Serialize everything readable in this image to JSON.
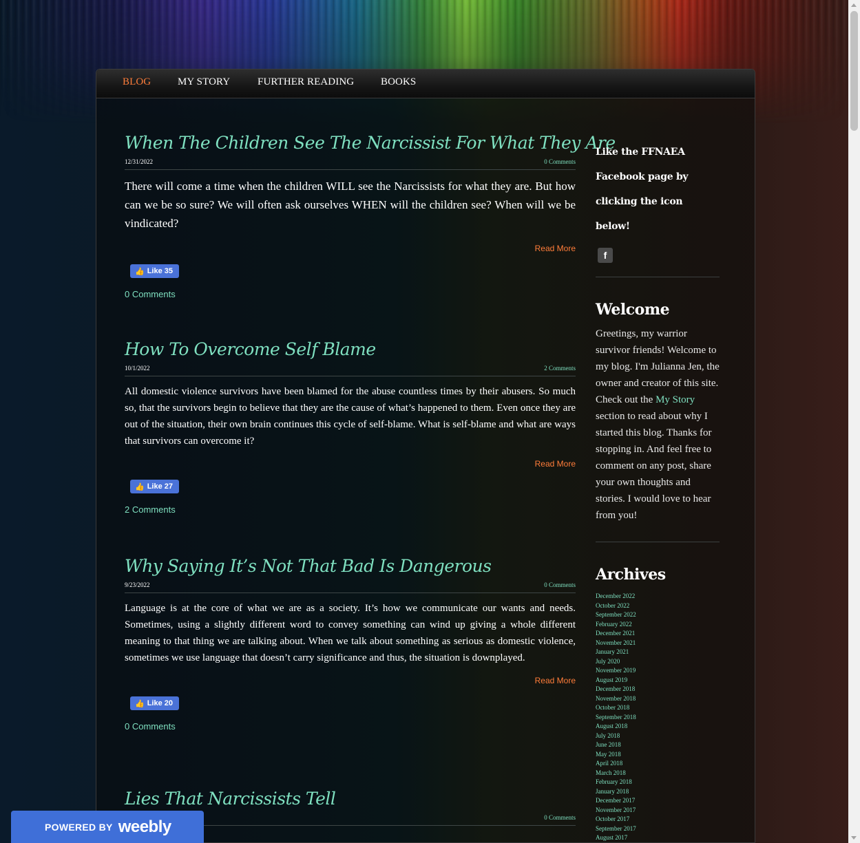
{
  "nav": {
    "items": [
      {
        "label": "BLOG",
        "active": true
      },
      {
        "label": "MY STORY",
        "active": false
      },
      {
        "label": "FURTHER READING",
        "active": false
      },
      {
        "label": "BOOKS",
        "active": false
      }
    ]
  },
  "posts": [
    {
      "title": "When The Children See The Narcissist For What They Are",
      "date": "12/31/2022",
      "comments_link": "0 Comments",
      "excerpt": "There will come a time when the children WILL see the Narcissists for what they are. But how can we be so sure? We will often ask ourselves WHEN will the children see? When will we be vindicated?",
      "read_more": "Read More",
      "like_label": "Like 35",
      "comments_count": "0 Comments"
    },
    {
      "title": "How To Overcome Self Blame",
      "date": "10/1/2022",
      "comments_link": "2 Comments",
      "excerpt": "All domestic violence survivors have been blamed for the abuse countless times by their abusers. So much so, that the survivors begin to believe that they are the cause of what’s happened to them. Even once they are out of the situation, their own brain continues this cycle of self-blame. What is self-blame and what are ways that survivors can overcome it?",
      "read_more": "Read More",
      "like_label": "Like 27",
      "comments_count": "2 Comments"
    },
    {
      "title": "Why Saying It’s Not That Bad Is Dangerous",
      "date": "9/23/2022",
      "comments_link": "0 Comments",
      "excerpt": "Language is at the core of what we are as a society. It’s how we communicate our wants and needs. Sometimes, using a slightly different word to convey something can wind up giving a whole different meaning to that thing we are talking about. When we talk about something as serious as domestic violence, sometimes we use language that doesn’t carry significance and thus, the situation is downplayed.",
      "read_more": "Read More",
      "like_label": "Like 20",
      "comments_count": "0 Comments"
    },
    {
      "title": "Lies That Narcissists Tell",
      "comments_link": "0 Comments"
    }
  ],
  "sidebar": {
    "fb_lines": [
      "Like the FFNAEA",
      "Facebook page by",
      "clicking the icon below!"
    ],
    "fb_icon": "f",
    "welcome_heading": "Welcome",
    "welcome_before": "Greetings, my warrior survivor friends! Welcome to my blog. I'm Julianna Jen, the owner and creator of this site. Check out the",
    "welcome_link": "My Story",
    "welcome_after": "section to read about why I started this blog. Thanks for stopping in. And feel free to comment on any post, share your own thoughts and stories. I would love to hear from you!",
    "archives_heading": "Archives",
    "archives": [
      "December 2022",
      "October 2022",
      "September 2022",
      "February 2022",
      "December 2021",
      "November 2021",
      "January 2021",
      "July 2020",
      "November 2019",
      "August 2019",
      "December 2018",
      "November 2018",
      "October 2018",
      "September 2018",
      "August 2018",
      "July 2018",
      "June 2018",
      "May 2018",
      "April 2018",
      "March 2018",
      "February 2018",
      "January 2018",
      "December 2017",
      "November 2017",
      "October 2017",
      "September 2017",
      "August 2017"
    ]
  },
  "weebly": {
    "powered_by": "POWERED BY",
    "brand": "weebly"
  },
  "colors": {
    "accent": "#7fe0c0",
    "active_nav": "#ff7d3a",
    "fb_like": "#4a72d8",
    "weebly_bar": "#3f6fd8"
  }
}
